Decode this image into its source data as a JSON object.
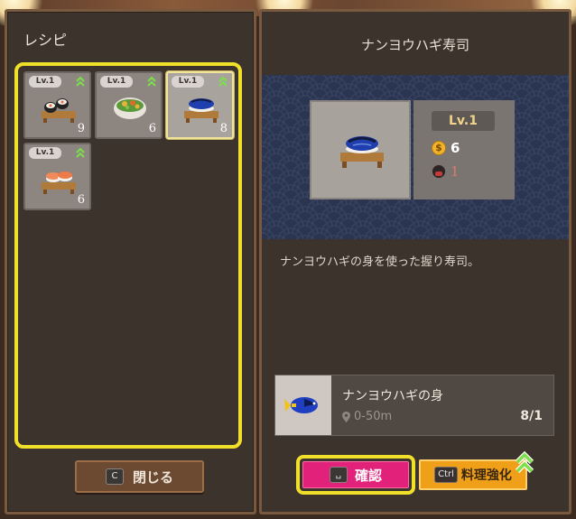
{
  "left_panel": {
    "title": "レシピ",
    "recipes": [
      {
        "level": "Lv.1",
        "count": "9",
        "upgradable": true,
        "selected": false,
        "art": "maki-sushi"
      },
      {
        "level": "Lv.1",
        "count": "6",
        "upgradable": true,
        "selected": false,
        "art": "salad-bowl"
      },
      {
        "level": "Lv.1",
        "count": "8",
        "upgradable": true,
        "selected": true,
        "art": "blue-tang-sushi"
      },
      {
        "level": "Lv.1",
        "count": "6",
        "upgradable": true,
        "selected": false,
        "art": "salmon-sushi"
      }
    ],
    "close_key": "C",
    "close_label": "閉じる"
  },
  "detail": {
    "title": "ナンヨウハギ寿司",
    "level": "Lv.1",
    "price": "6",
    "cook_count": "1",
    "description": "ナンヨウハギの身を使った握り寿司。",
    "ingredient": {
      "name": "ナンヨウハギの身",
      "location": "0-50m",
      "quantity": "8/1"
    }
  },
  "actions": {
    "confirm_key": "␣",
    "confirm_label": "確認",
    "enhance_key": "Ctrl",
    "enhance_label": "料理強化"
  },
  "colors": {
    "highlight": "#f0e02a",
    "confirm": "#e2227a",
    "enhance": "#f0a018",
    "upgrade_arrow": "#7be04a"
  }
}
